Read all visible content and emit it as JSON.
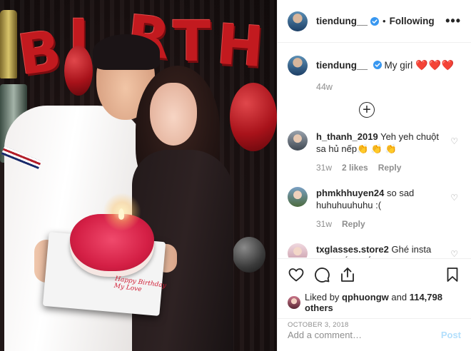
{
  "header": {
    "username": "tiendung__",
    "separator": "•",
    "follow_status": "Following",
    "more_label": "•••"
  },
  "caption": {
    "username": "tiendung__",
    "text": "My girl",
    "hearts": "❤️❤️❤️",
    "age": "44w"
  },
  "comments": [
    {
      "username": "h_thanh_2019",
      "text": "Yeh yeh chuột sa hủ nếp👏 👏 👏",
      "age": "31w",
      "likes": "2 likes",
      "reply": "Reply"
    },
    {
      "username": "phmkhhuyen24",
      "text": "so sad huhuhuuhuhu :(",
      "age": "31w",
      "reply": "Reply"
    },
    {
      "username": "txglasses.store2",
      "text": "Ghé insta shop sắm mắt kính đeo Tết bạn nhé"
    }
  ],
  "likes": {
    "prefix": "Liked by",
    "user": "qphuongw",
    "conj": "and",
    "count": "114,798 others"
  },
  "date": "OCTOBER 3, 2018",
  "add_comment": {
    "placeholder": "Add a comment…",
    "post_label": "Post"
  },
  "photo": {
    "balloon_letters": [
      "B",
      "I",
      "R",
      "T",
      "H"
    ],
    "cake_text_line1": "Happy Birthday",
    "cake_text_line2": "My Love"
  },
  "colors": {
    "verified": "#3897f0",
    "heart": "#e0161c",
    "post_disabled": "#b2dffc",
    "muted": "#8e8e8e"
  }
}
